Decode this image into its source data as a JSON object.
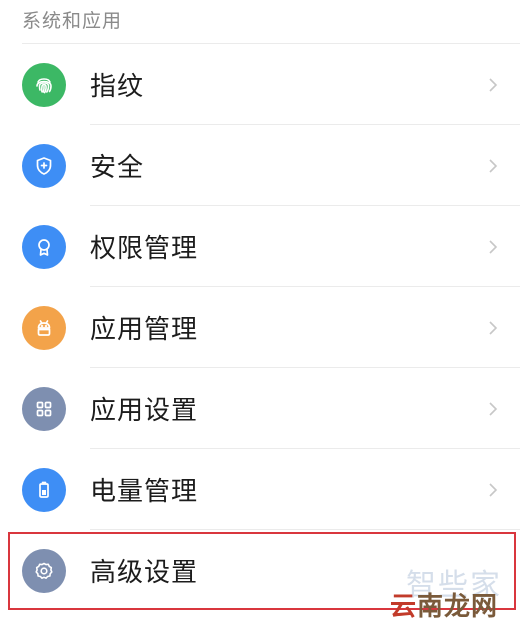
{
  "section": {
    "title": "系统和应用"
  },
  "items": [
    {
      "label": "指纹",
      "icon": "fingerprint-icon",
      "color": "#3cb865"
    },
    {
      "label": "安全",
      "icon": "shield-icon",
      "color": "#3e8ef5"
    },
    {
      "label": "权限管理",
      "icon": "badge-icon",
      "color": "#3e8ef5"
    },
    {
      "label": "应用管理",
      "icon": "android-icon",
      "color": "#f3a34a"
    },
    {
      "label": "应用设置",
      "icon": "grid-icon",
      "color": "#7e8fb0"
    },
    {
      "label": "电量管理",
      "icon": "battery-icon",
      "color": "#3e8ef5"
    },
    {
      "label": "高级设置",
      "icon": "gear-icon",
      "color": "#7e8fb0"
    }
  ],
  "highlight": {
    "color": "#d9363e"
  },
  "watermarks": {
    "zhixiejia": "智些家",
    "yunnan_prefix": "云",
    "yunnan_rest": "南龙网"
  }
}
